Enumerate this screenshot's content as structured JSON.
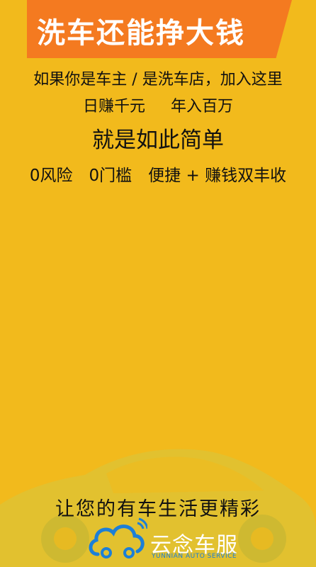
{
  "banner": {
    "title": "洗车还能挣大钱"
  },
  "intro": {
    "line1": "如果你是车主 / 是洗车店，加入这里",
    "line2_left": "日赚千元",
    "line2_right": "年入百万",
    "line3": "就是如此简单",
    "line4": "0风险　0门槛　便捷 + 赚钱双丰收"
  },
  "footer": {
    "slogan": "让您的有车生活更精彩",
    "brand_name": "云念车服",
    "brand_sub": "YUNNIAN AUTO SERVICE"
  },
  "colors": {
    "background": "#f2ba1c",
    "banner": "#f47a20",
    "brand_blue": "#1d7fd6"
  }
}
